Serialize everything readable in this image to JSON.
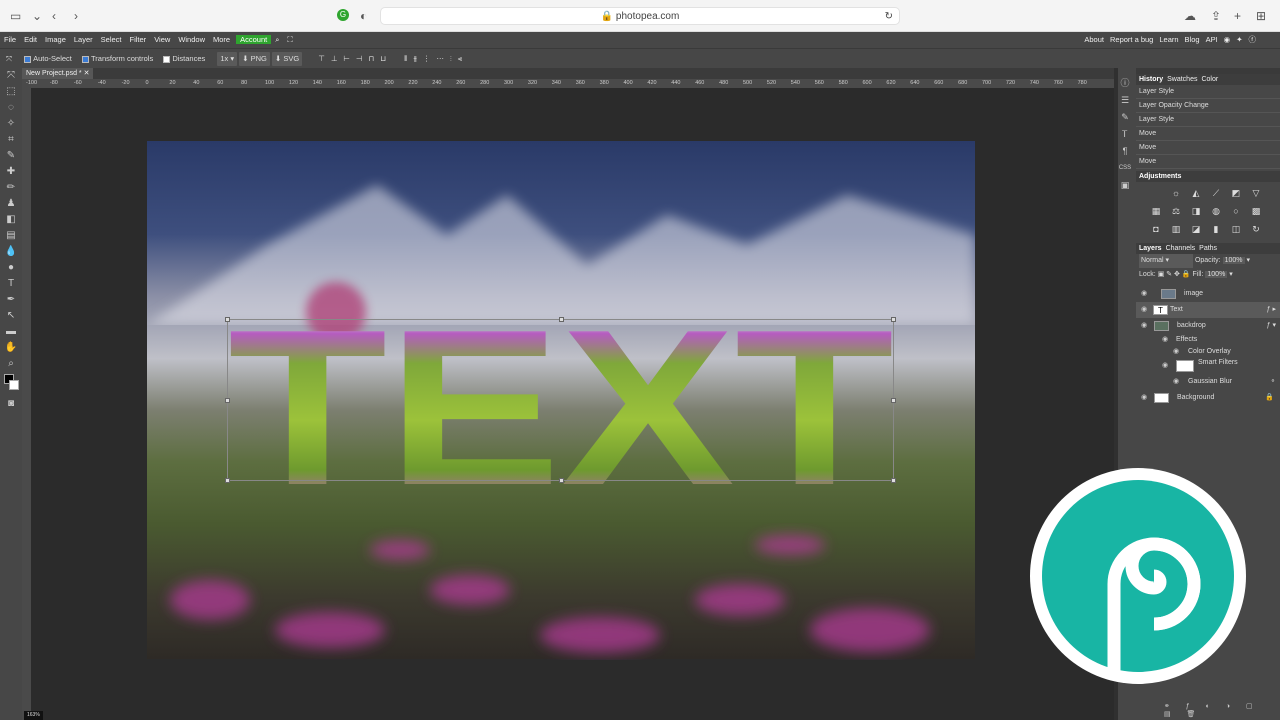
{
  "browser": {
    "url": "photopea.com"
  },
  "menu": {
    "items": [
      "File",
      "Edit",
      "Image",
      "Layer",
      "Select",
      "Filter",
      "View",
      "Window",
      "More"
    ],
    "account": "Account",
    "right": [
      "About",
      "Report a bug",
      "Learn",
      "Blog",
      "API"
    ]
  },
  "options": {
    "auto_select": "Auto-Select",
    "transform_controls": "Transform controls",
    "distances": "Distances",
    "zoom": "1x",
    "png": "PNG",
    "svg": "SVG"
  },
  "document": {
    "tab": "New Project.psd *",
    "text": "TEXT"
  },
  "ruler": {
    "ticks": [
      "-100",
      "-80",
      "-60",
      "-40",
      "-20",
      "0",
      "20",
      "40",
      "60",
      "80",
      "100",
      "120",
      "140",
      "160",
      "180",
      "200",
      "220",
      "240",
      "260",
      "280",
      "300",
      "320",
      "340",
      "360",
      "380",
      "400",
      "420",
      "440",
      "460",
      "480",
      "500",
      "520",
      "540",
      "560",
      "580",
      "600",
      "620",
      "640",
      "660",
      "680",
      "700",
      "720",
      "740",
      "760",
      "780"
    ]
  },
  "history": {
    "tabs": [
      "History",
      "Swatches",
      "Color"
    ],
    "items": [
      "Layer Style",
      "Layer Opacity Change",
      "Layer Style",
      "Move",
      "Move",
      "Move"
    ]
  },
  "adjustments": {
    "title": "Adjustments"
  },
  "layers": {
    "tabs": [
      "Layers",
      "Channels",
      "Paths"
    ],
    "blend": "Normal",
    "opacity_label": "Opacity:",
    "opacity": "100%",
    "lock_label": "Lock:",
    "fill_label": "Fill:",
    "fill": "100%",
    "rows": {
      "image": "image",
      "text": "Text",
      "backdrop": "backdrop",
      "effects": "Effects",
      "color_overlay": "Color Overlay",
      "smart_filters": "Smart Filters",
      "gaussian_blur": "Gaussian Blur",
      "background": "Background"
    }
  },
  "status": {
    "zoom": "163%"
  },
  "colors": {
    "accent": "#2fa52f",
    "logo": "#18b5a4"
  }
}
